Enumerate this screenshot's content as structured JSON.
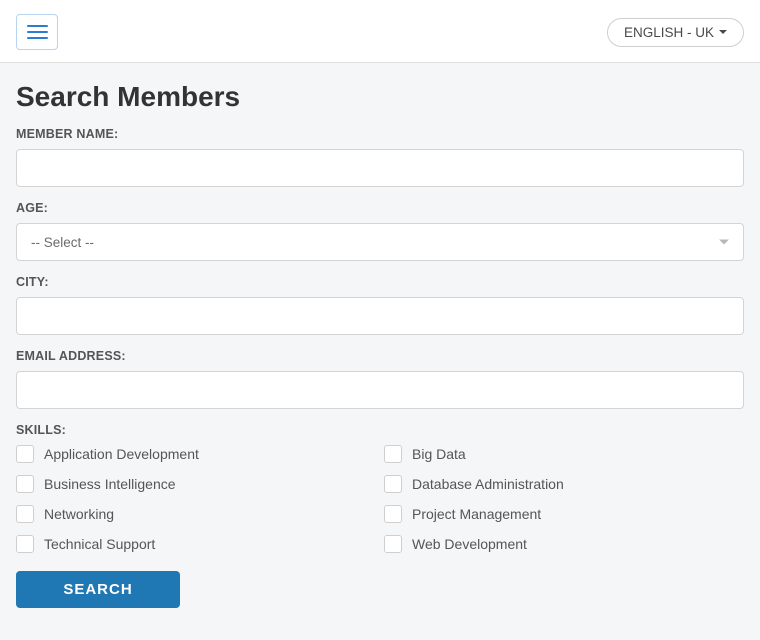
{
  "navbar": {
    "lang_label": "ENGLISH - UK"
  },
  "page": {
    "title": "Search Members"
  },
  "form": {
    "member_name": {
      "label": "MEMBER NAME:",
      "value": ""
    },
    "age": {
      "label": "AGE:",
      "placeholder": "-- Select --"
    },
    "city": {
      "label": "CITY:",
      "value": ""
    },
    "email": {
      "label": "EMAIL ADDRESS:",
      "value": ""
    },
    "skills_label": "SKILLS:",
    "skills": [
      {
        "label": "Application Development"
      },
      {
        "label": "Big Data"
      },
      {
        "label": "Business Intelligence"
      },
      {
        "label": "Database Administration"
      },
      {
        "label": "Networking"
      },
      {
        "label": "Project Management"
      },
      {
        "label": "Technical Support"
      },
      {
        "label": "Web Development"
      }
    ],
    "search_button": "SEARCH"
  }
}
